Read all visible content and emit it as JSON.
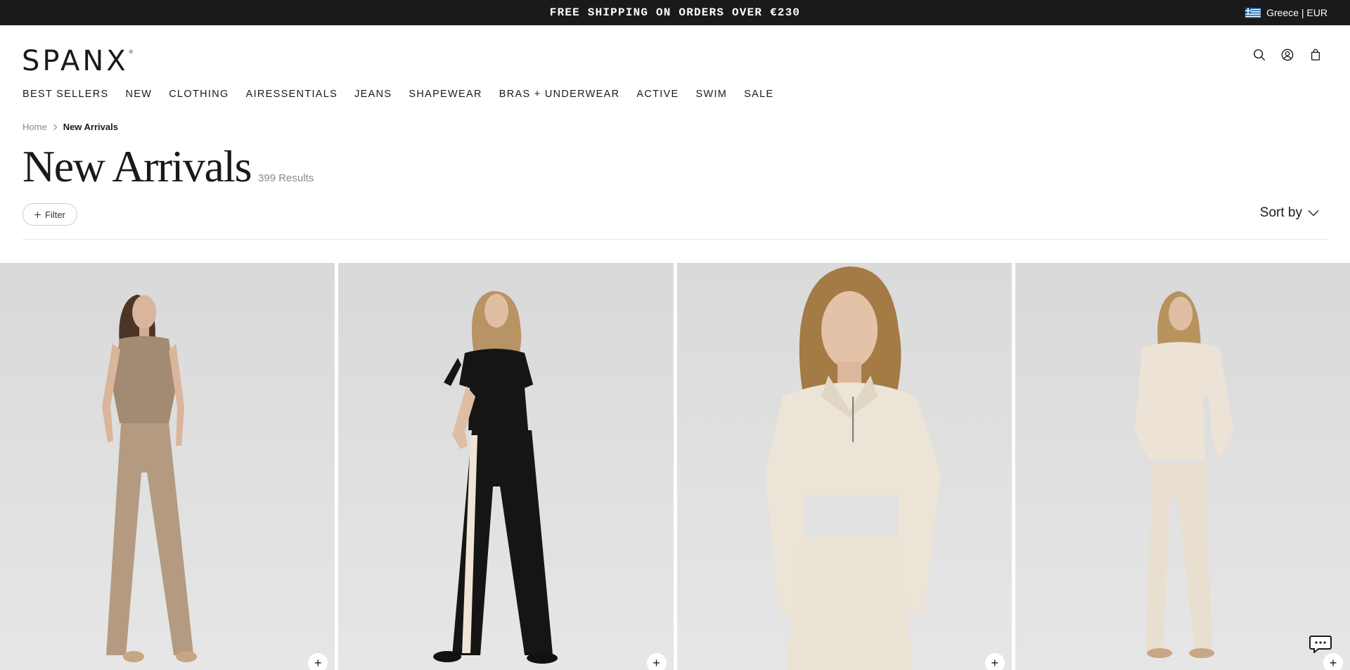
{
  "topbar": {
    "promo": "FREE SHIPPING ON ORDERS OVER €230",
    "locale": "Greece | EUR"
  },
  "header": {
    "logo": "SPANX",
    "logo_mark": "®",
    "icons": [
      "search-icon",
      "account-icon",
      "bag-icon"
    ]
  },
  "nav": {
    "items": [
      "BEST SELLERS",
      "NEW",
      "CLOTHING",
      "AIRESSENTIALS",
      "JEANS",
      "SHAPEWEAR",
      "BRAS + UNDERWEAR",
      "ACTIVE",
      "SWIM",
      "SALE"
    ]
  },
  "breadcrumb": {
    "home": "Home",
    "current": "New Arrivals"
  },
  "page": {
    "title": "New Arrivals",
    "results": "399 Results"
  },
  "toolbar": {
    "filter_label": "Filter",
    "sort_label": "Sort by"
  },
  "products": [
    {
      "add_label": "+"
    },
    {
      "add_label": "+"
    },
    {
      "add_label": "+"
    },
    {
      "add_label": "+"
    }
  ],
  "colors": {
    "topbar_bg": "#1a1a1a",
    "card_bg": "#e2e2e2"
  }
}
